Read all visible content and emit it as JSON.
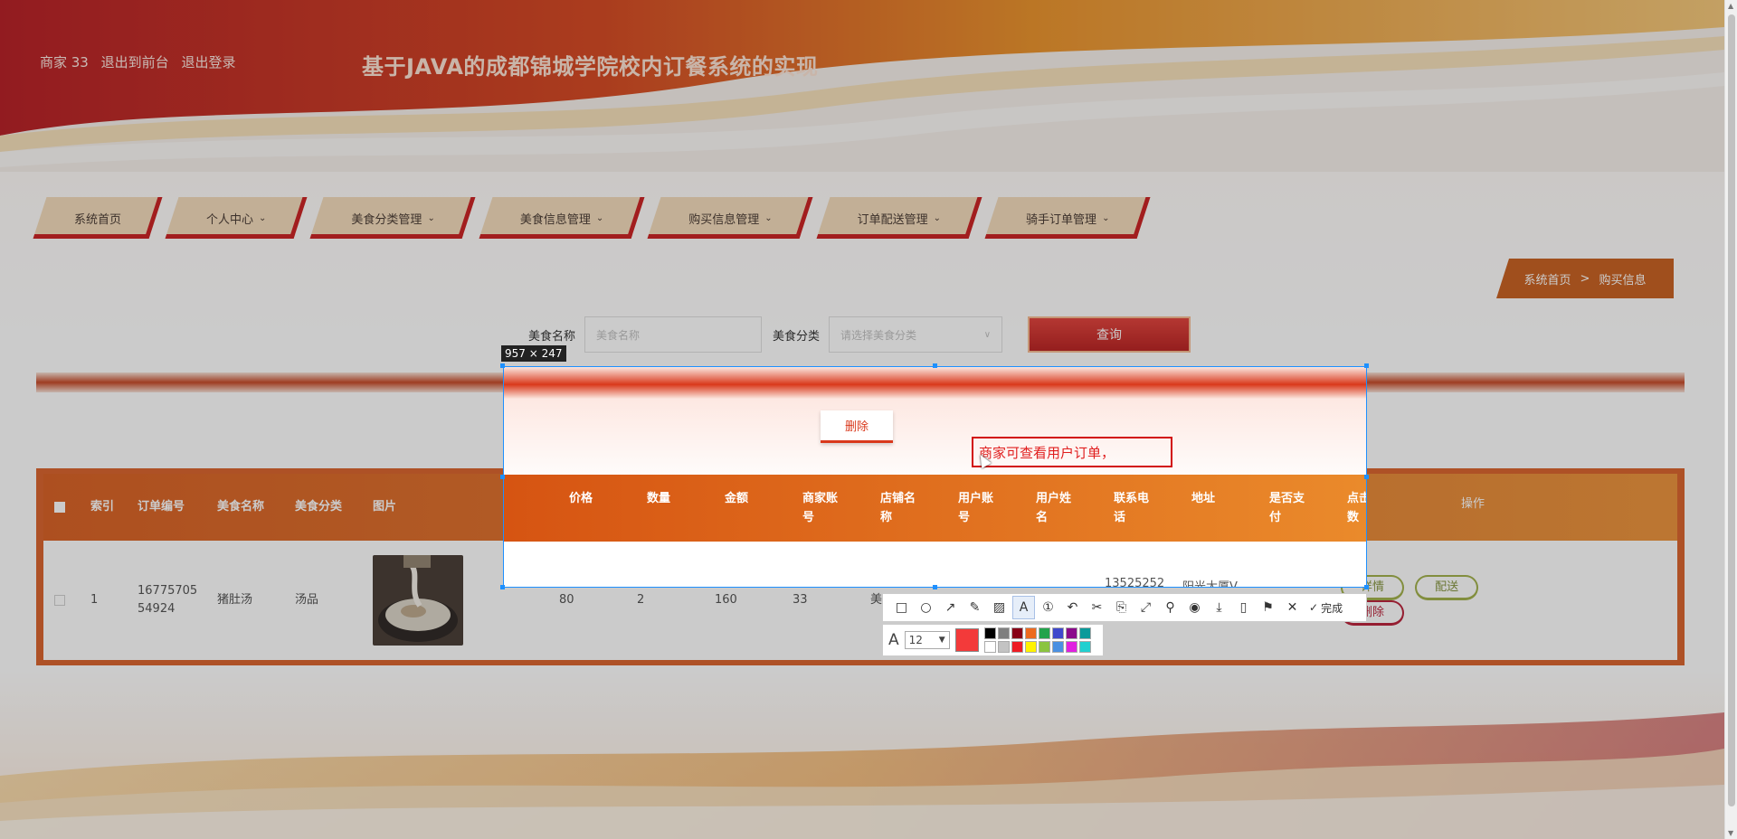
{
  "header": {
    "user_label": "商家 33",
    "to_front": "退出到前台",
    "logout": "退出登录",
    "site_title": "基于JAVA的成都锦城学院校内订餐系统的实现"
  },
  "nav": {
    "items": [
      {
        "label": "系统首页",
        "has_menu": false
      },
      {
        "label": "个人中心",
        "has_menu": true
      },
      {
        "label": "美食分类管理",
        "has_menu": true
      },
      {
        "label": "美食信息管理",
        "has_menu": true
      },
      {
        "label": "购买信息管理",
        "has_menu": true
      },
      {
        "label": "订单配送管理",
        "has_menu": true
      },
      {
        "label": "骑手订单管理",
        "has_menu": true
      }
    ],
    "chevron": "⌄"
  },
  "breadcrumb": {
    "home": "系统首页",
    "sep": ">",
    "current": "购买信息"
  },
  "search": {
    "name_label": "美食名称",
    "name_placeholder": "美食名称",
    "category_label": "美食分类",
    "category_placeholder": "请选择美食分类",
    "button": "查询"
  },
  "table": {
    "columns": [
      "索引",
      "订单编号",
      "美食名称",
      "美食分类",
      "图片",
      "价格",
      "数量",
      "金额",
      "商家账号",
      "店铺名称",
      "用户账号",
      "用户姓名",
      "联系电话",
      "地址",
      "是否支付",
      "点击次数",
      "操作"
    ],
    "columns_display": [
      "索引",
      "订单编号",
      "美食名称",
      "美食分类",
      "图片",
      "价格",
      "数量",
      "金额",
      "商家账号",
      "店铺名称",
      "用户账号",
      "用户姓名",
      "联系电话",
      "地址",
      "是否支付",
      "点击次数",
      "操作"
    ],
    "row": {
      "index": "1",
      "order_no_a": "16775705",
      "order_no_b": "54924",
      "food_name": "猪肚汤",
      "category": "汤品",
      "price": "80",
      "qty": "2",
      "amount": "160",
      "merchant": "33",
      "shop_partial": "美",
      "phone_partial": "13525252",
      "address_partial": "阳光大厦V"
    },
    "ops": {
      "detail": "详情",
      "deliver": "配送",
      "delete": "删除"
    }
  },
  "capture": {
    "size_label": "957 × 247",
    "delete_label": "删除",
    "note_text": "商家可查看用户订单，"
  },
  "toolbar": {
    "tools": [
      "rect-tool-icon",
      "ellipse-tool-icon",
      "arrow-tool-icon",
      "pen-tool-icon",
      "mosaic-tool-icon",
      "text-tool-icon",
      "number-tool-icon",
      "undo-icon",
      "cut-icon",
      "ocr-icon",
      "scroll-capture-icon",
      "pin-icon",
      "record-icon",
      "save-icon",
      "phone-icon",
      "bookmark-icon",
      "close-icon"
    ],
    "done": "完成",
    "font_size": "12",
    "current_color": "#f33a3a",
    "palette": [
      "#000000",
      "#7f7f7f",
      "#880015",
      "#ed6a1e",
      "#22a34b",
      "#3f48cc",
      "#8b0a8b",
      "#0a9a9a",
      "#ffffff",
      "#c3c3c3",
      "#ed1c24",
      "#fff200",
      "#8ac43f",
      "#4a90e2",
      "#e020e0",
      "#20d0d0"
    ]
  }
}
